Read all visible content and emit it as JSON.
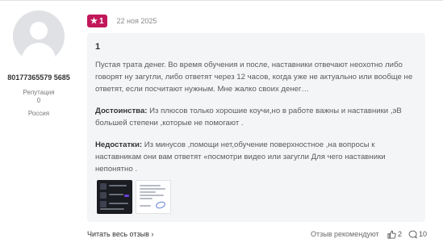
{
  "author": {
    "name": "80177365579 5685",
    "reputation_label": "Репутация",
    "reputation_value": "0",
    "country": "Россия"
  },
  "review": {
    "rating": "1",
    "date": "22 ноя 2025",
    "title": "1",
    "text": "Пустая трата денег. Во время обучения и после, наставники отвечают неохотно либо говорят ну загугли, либо ответят через 12 часов, когда уже не актуально или вообще не ответят, если посчитают нужным. Мне жалко своих денег…",
    "pros_label": "Достоинства:",
    "pros_text": "Из плюсов только хорошие коучи,но в работе важны и наставники ,эВ большей степени ,которые не помогают .",
    "cons_label": "Недостатки:",
    "cons_text": "Из минусов ,помощи нет,обучение поверхностное ,на вопросы к наставникам они вам ответят «посмотри видео или загугли Для чего наставники непонятно ."
  },
  "footer": {
    "read_all": "Читать весь отзыв",
    "recommend": "Отзыв рекомендуют",
    "likes": "2",
    "comments": "10"
  },
  "colors": {
    "badge": "#c2185b",
    "review_bg": "#f4f5f7"
  },
  "icons": [
    "star-icon",
    "chevron-right-icon",
    "thumbs-up-icon",
    "comment-icon"
  ]
}
